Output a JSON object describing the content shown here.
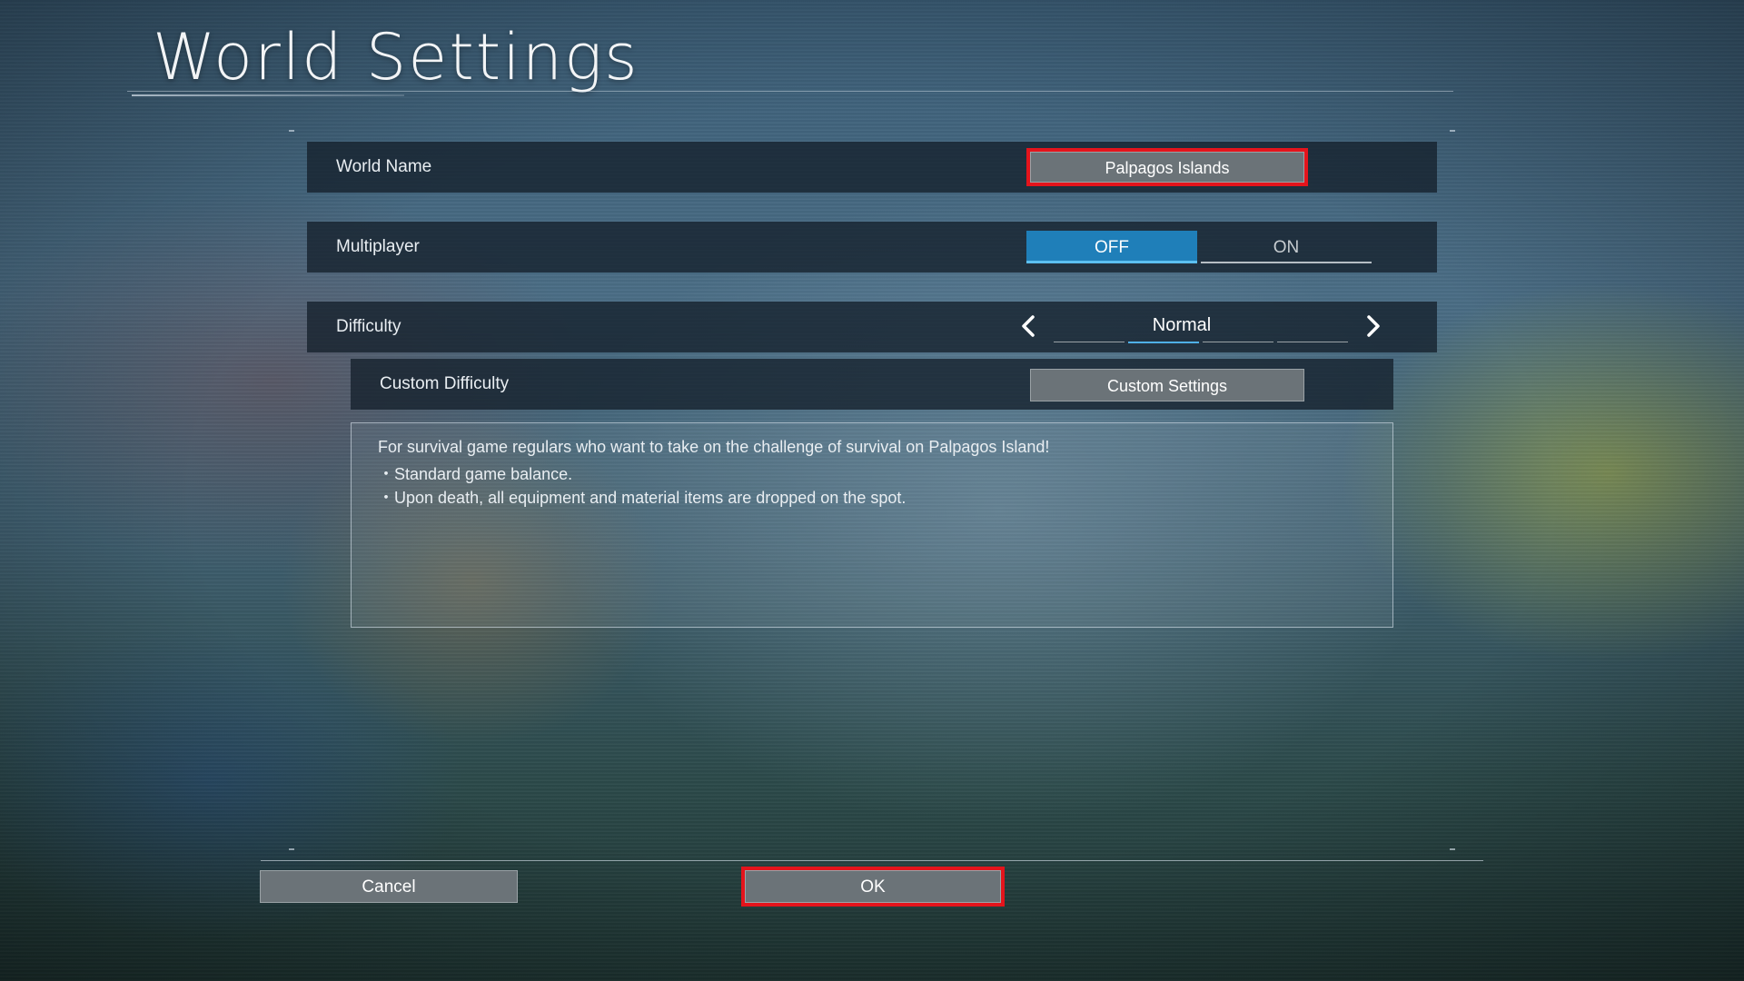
{
  "page": {
    "title": "World Settings"
  },
  "settings": {
    "world_name": {
      "label": "World Name",
      "value": "Palpagos Islands"
    },
    "multiplayer": {
      "label": "Multiplayer",
      "options": [
        "OFF",
        "ON"
      ],
      "selected": "OFF"
    },
    "difficulty": {
      "label": "Difficulty",
      "value": "Normal",
      "prev_icon": "chevron-left-icon",
      "next_icon": "chevron-right-icon"
    },
    "custom_difficulty": {
      "label": "Custom Difficulty",
      "button_label": "Custom Settings"
    }
  },
  "description": {
    "lines": [
      "For survival game regulars who want to take on the challenge of survival on Palpagos Island!",
      "・Standard game balance.",
      "・Upon death, all equipment and material items are dropped on the spot."
    ]
  },
  "footer": {
    "cancel_label": "Cancel",
    "ok_label": "OK"
  },
  "colors": {
    "accent_blue": "#1f7fb9",
    "highlight_red": "#e4141c",
    "button_gray": "#6b7378"
  }
}
